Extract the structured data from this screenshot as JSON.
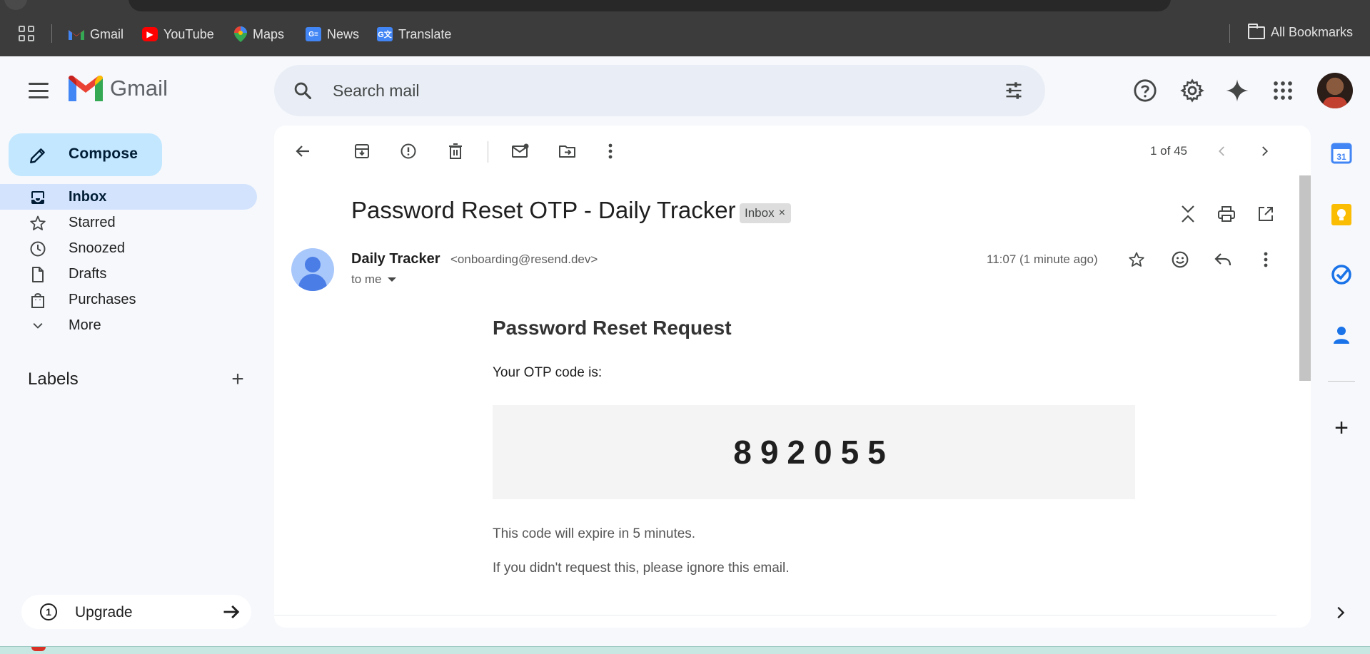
{
  "bookmarks": {
    "items": [
      {
        "label": "Gmail"
      },
      {
        "label": "YouTube"
      },
      {
        "label": "Maps"
      },
      {
        "label": "News"
      },
      {
        "label": "Translate"
      }
    ],
    "all_label": "All Bookmarks"
  },
  "header": {
    "app_name": "Gmail",
    "search_placeholder": "Search mail"
  },
  "sidebar": {
    "compose_label": "Compose",
    "items": [
      {
        "label": "Inbox",
        "icon": "inbox-icon",
        "active": true
      },
      {
        "label": "Starred",
        "icon": "star-icon"
      },
      {
        "label": "Snoozed",
        "icon": "clock-icon"
      },
      {
        "label": "Drafts",
        "icon": "draft-icon"
      },
      {
        "label": "Purchases",
        "icon": "shopping-bag-icon"
      },
      {
        "label": "More",
        "icon": "chevron-down-icon"
      }
    ],
    "labels_heading": "Labels",
    "upgrade_label": "Upgrade"
  },
  "toolbar": {
    "pager": "1 of 45"
  },
  "email": {
    "subject": "Password Reset OTP - Daily Tracker",
    "chip": "Inbox",
    "sender_name": "Daily Tracker",
    "sender_email": "<onboarding@resend.dev>",
    "to": "to me",
    "time": "11:07 (1 minute ago)",
    "body": {
      "heading": "Password Reset Request",
      "lead": "Your OTP code is:",
      "code": "892055",
      "expiry": "This code will expire in 5 minutes.",
      "ignore": "If you didn't request this, please ignore this email."
    }
  },
  "colors": {
    "accent": "#0b57d0",
    "compose_bg": "#c2e7ff",
    "active_nav": "#d3e3fd",
    "background": "#f6f8fc"
  }
}
